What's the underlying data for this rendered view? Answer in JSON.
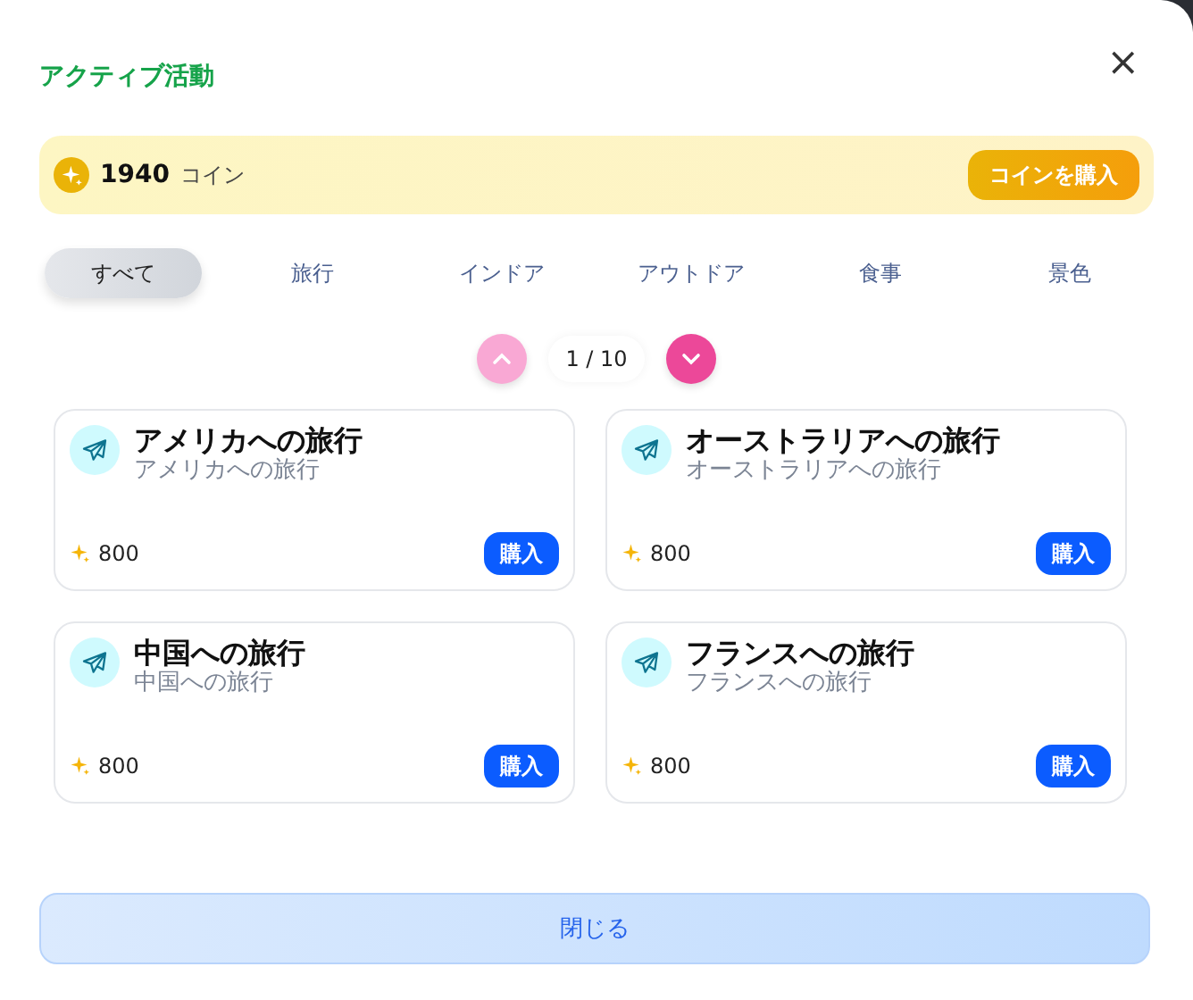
{
  "dialog": {
    "title": "アクティブ活動",
    "close_symbol": "×"
  },
  "coins": {
    "amount": "1940",
    "unit": "コイン",
    "buy_label": "コインを購入"
  },
  "tabs": [
    {
      "label": "すべて",
      "selected": true
    },
    {
      "label": "旅行",
      "selected": false
    },
    {
      "label": "インドア",
      "selected": false
    },
    {
      "label": "アウトドア",
      "selected": false
    },
    {
      "label": "食事",
      "selected": false
    },
    {
      "label": "景色",
      "selected": false
    }
  ],
  "pager": {
    "text": "1 / 10",
    "prev_disabled": true,
    "next_disabled": false
  },
  "cards": [
    {
      "title": "アメリカへの旅行",
      "subtitle": "アメリカへの旅行",
      "price": "800",
      "buy_label": "購入"
    },
    {
      "title": "オーストラリアへの旅行",
      "subtitle": "オーストラリアへの旅行",
      "price": "800",
      "buy_label": "購入"
    },
    {
      "title": "中国への旅行",
      "subtitle": "中国への旅行",
      "price": "800",
      "buy_label": "購入"
    },
    {
      "title": "フランスへの旅行",
      "subtitle": "フランスへの旅行",
      "price": "800",
      "buy_label": "購入"
    }
  ],
  "close_button": "閉じる"
}
